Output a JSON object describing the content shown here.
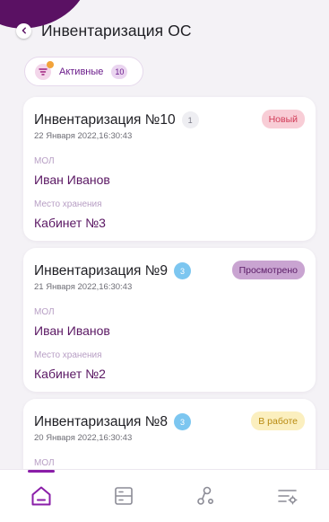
{
  "header": {
    "title": "Инвентаризация ОС"
  },
  "filter": {
    "label": "Активные",
    "count": "10"
  },
  "cards": [
    {
      "title": "Инвентаризация №10",
      "count": "1",
      "date": "22 Января 2022,16:30:43",
      "status": "Новый",
      "mol_label": "МОЛ",
      "mol_value": "Иван Иванов",
      "place_label": "Место хранения",
      "place_value": "Кабинет №3"
    },
    {
      "title": "Инвентаризация №9",
      "count": "3",
      "date": "21 Января 2022,16:30:43",
      "status": "Просмотрено",
      "mol_label": "МОЛ",
      "mol_value": "Иван Иванов",
      "place_label": "Место хранения",
      "place_value": "Кабинет №2"
    },
    {
      "title": "Инвентаризация №8",
      "count": "3",
      "date": "20 Января 2022,16:30:43",
      "status": "В работе",
      "mol_label": "МОЛ"
    }
  ],
  "nav": {
    "items": [
      "home-icon",
      "list-icon",
      "nodes-icon",
      "settings-icon"
    ],
    "active": "home-icon"
  },
  "colors": {
    "accent": "#8a1ea8",
    "brand_dark": "#5a1163",
    "value_text": "#5a1763",
    "status_new": "#d13b57",
    "status_viewed": "#5a1b66",
    "status_work": "#b88a10"
  }
}
